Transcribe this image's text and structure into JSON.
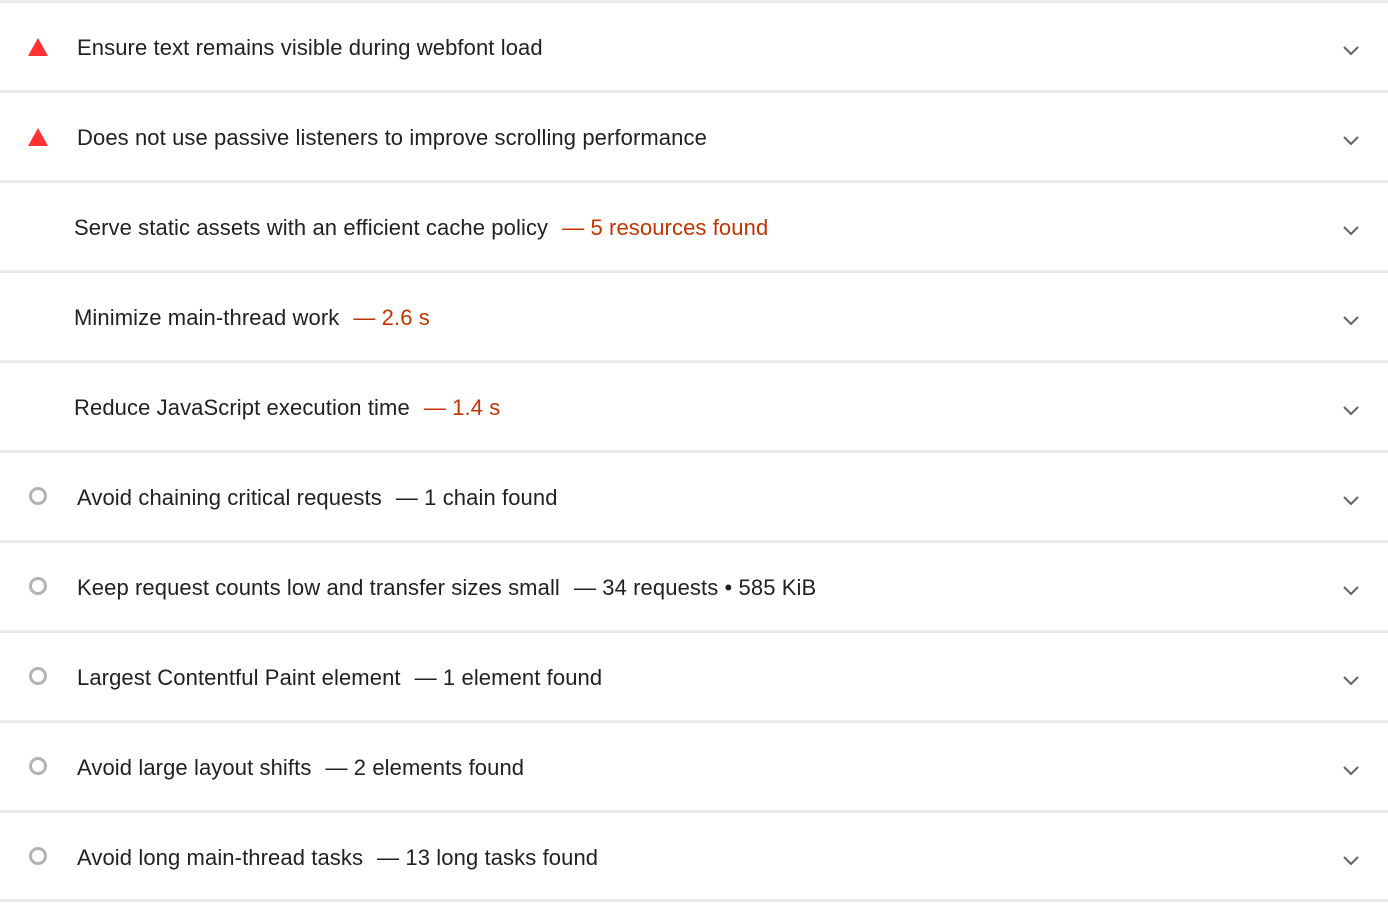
{
  "audits": [
    {
      "title": "Ensure text remains visible during webfont load",
      "display": "",
      "status": "fail",
      "status_icon": "warning-triangle-icon"
    },
    {
      "title": "Does not use passive listeners to improve scrolling performance",
      "display": "",
      "status": "fail",
      "status_icon": "warning-triangle-icon"
    },
    {
      "title": "Serve static assets with an efficient cache policy",
      "display": "— 5 resources found",
      "status": "warn",
      "status_icon": ""
    },
    {
      "title": "Minimize main-thread work",
      "display": "— 2.6 s",
      "status": "warn",
      "status_icon": ""
    },
    {
      "title": "Reduce JavaScript execution time",
      "display": "— 1.4 s",
      "status": "warn",
      "status_icon": ""
    },
    {
      "title": "Avoid chaining critical requests",
      "display": "— 1 chain found",
      "status": "info",
      "status_icon": "info-circle-icon"
    },
    {
      "title": "Keep request counts low and transfer sizes small",
      "display": "— 34 requests • 585 KiB",
      "status": "info",
      "status_icon": "info-circle-icon"
    },
    {
      "title": "Largest Contentful Paint element",
      "display": "— 1 element found",
      "status": "info",
      "status_icon": "info-circle-icon"
    },
    {
      "title": "Avoid large layout shifts",
      "display": "— 2 elements found",
      "status": "info",
      "status_icon": "info-circle-icon"
    },
    {
      "title": "Avoid long main-thread tasks",
      "display": "— 13 long tasks found",
      "status": "info",
      "status_icon": "info-circle-icon"
    }
  ],
  "colors": {
    "fail": "#ff3333",
    "warn_text": "#c33300",
    "info_icon": "#b3b3b3",
    "divider": "#ebebeb",
    "chevron": "#616161"
  }
}
